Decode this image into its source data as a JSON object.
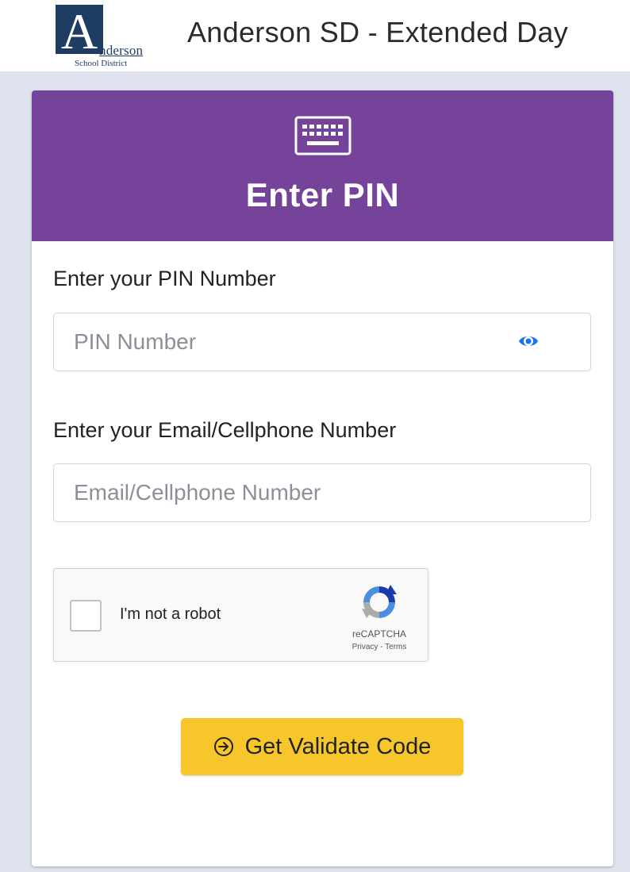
{
  "header": {
    "logo": {
      "letter": "A",
      "name": "nderson",
      "subtitle": "School District"
    },
    "title": "Anderson SD - Extended Day"
  },
  "card": {
    "header_icon": "keyboard-icon",
    "title": "Enter PIN",
    "pin": {
      "label": "Enter your PIN Number",
      "placeholder": "PIN Number",
      "value": "",
      "toggle_icon": "eye-icon"
    },
    "contact": {
      "label": "Enter your Email/Cellphone Number",
      "placeholder": "Email/Cellphone Number",
      "value": ""
    },
    "recaptcha": {
      "label": "I'm not a robot",
      "checked": false,
      "brand": "reCAPTCHA",
      "privacy": "Privacy",
      "separator": "-",
      "terms": "Terms"
    },
    "submit": {
      "icon": "arrow-circle-right-icon",
      "label": "Get Validate Code"
    }
  },
  "colors": {
    "accent_purple": "#754399",
    "button_yellow": "#f6c62b",
    "eye_blue": "#1a73e8",
    "page_background": "#dfe3ed"
  }
}
